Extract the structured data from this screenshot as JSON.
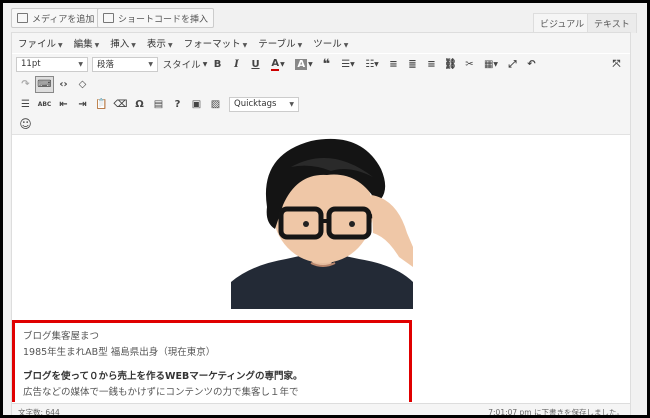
{
  "media_buttons": {
    "add_media": "メディアを追加",
    "insert_shortcode": "ショートコードを挿入"
  },
  "mode_tabs": {
    "visual": "ビジュアル",
    "text": "テキスト"
  },
  "menubar": [
    "ファイル",
    "編集",
    "挿入",
    "表示",
    "フォーマット",
    "テーブル",
    "ツール"
  ],
  "toolbar": {
    "font_size": "11pt",
    "block_format": "段落",
    "style_label": "スタイル",
    "quicktags": "Quicktags"
  },
  "content": {
    "line1": "ブログ集客屋まつ",
    "line2": "1985年生まれAB型 福島県出身（現在東京）",
    "line3": "ブログを使って０から売上を作るWEBマーケティングの専門家。",
    "line4": "広告などの媒体で一銭もかけずにコンテンツの力で集客し１年で"
  },
  "status": {
    "word_count": "文字数: 644",
    "autosave": "7:01:07 pm に下書きを保存しました。"
  },
  "colors": {
    "highlight_border": "#e00000"
  }
}
